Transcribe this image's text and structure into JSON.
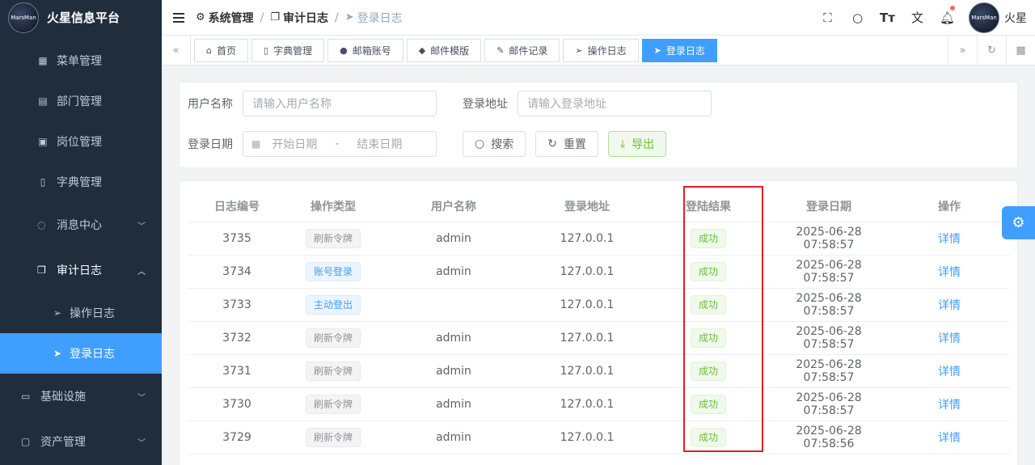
{
  "app": {
    "title": "火星信息平台",
    "logo_text": "MarsMan"
  },
  "sidebar": {
    "items": [
      {
        "label": "菜单管理"
      },
      {
        "label": "部门管理"
      },
      {
        "label": "岗位管理"
      },
      {
        "label": "字典管理"
      }
    ],
    "groups": {
      "message": {
        "label": "消息中心"
      },
      "audit": {
        "label": "审计日志",
        "children": [
          {
            "label": "操作日志"
          },
          {
            "label": "登录日志"
          }
        ]
      },
      "infra": {
        "label": "基础设施"
      },
      "assets": {
        "label": "资产管理"
      }
    }
  },
  "header": {
    "breadcrumb": [
      "系统管理",
      "审计日志",
      "登录日志"
    ],
    "username": "火星"
  },
  "tags": [
    "首页",
    "字典管理",
    "邮箱账号",
    "邮件模版",
    "邮件记录",
    "操作日志",
    "登录日志"
  ],
  "search": {
    "username_label": "用户名称",
    "username_placeholder": "请输入用户名称",
    "address_label": "登录地址",
    "address_placeholder": "请输入登录地址",
    "date_label": "登录日期",
    "date_start": "开始日期",
    "date_sep": "-",
    "date_end": "结束日期",
    "search_btn": "搜索",
    "reset_btn": "重置",
    "export_btn": "导出"
  },
  "table": {
    "headers": [
      "日志编号",
      "操作类型",
      "用户名称",
      "登录地址",
      "登陆结果",
      "登录日期",
      "操作"
    ],
    "rows": [
      {
        "id": "3735",
        "type": "刷新令牌",
        "type_style": "info",
        "user": "admin",
        "ip": "127.0.0.1",
        "result": "成功",
        "date": "2025-06-28 07:58:57",
        "action": "详情"
      },
      {
        "id": "3734",
        "type": "账号登录",
        "type_style": "primary",
        "user": "admin",
        "ip": "127.0.0.1",
        "result": "成功",
        "date": "2025-06-28 07:58:57",
        "action": "详情"
      },
      {
        "id": "3733",
        "type": "主动登出",
        "type_style": "primary",
        "user": "",
        "ip": "127.0.0.1",
        "result": "成功",
        "date": "2025-06-28 07:58:57",
        "action": "详情"
      },
      {
        "id": "3732",
        "type": "刷新令牌",
        "type_style": "info",
        "user": "admin",
        "ip": "127.0.0.1",
        "result": "成功",
        "date": "2025-06-28 07:58:57",
        "action": "详情"
      },
      {
        "id": "3731",
        "type": "刷新令牌",
        "type_style": "info",
        "user": "admin",
        "ip": "127.0.0.1",
        "result": "成功",
        "date": "2025-06-28 07:58:57",
        "action": "详情"
      },
      {
        "id": "3730",
        "type": "刷新令牌",
        "type_style": "info",
        "user": "admin",
        "ip": "127.0.0.1",
        "result": "成功",
        "date": "2025-06-28 07:58:57",
        "action": "详情"
      },
      {
        "id": "3729",
        "type": "刷新令牌",
        "type_style": "info",
        "user": "admin",
        "ip": "127.0.0.1",
        "result": "成功",
        "date": "2025-06-28 07:58:56",
        "action": "详情"
      }
    ]
  },
  "colors": {
    "accent": "#409eff",
    "sidebar_bg": "#1f2d3d",
    "success": "#67c23a",
    "highlight_box": "#e02020"
  }
}
